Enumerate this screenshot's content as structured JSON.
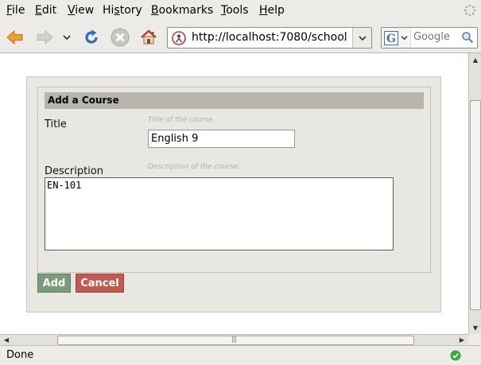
{
  "menubar": {
    "items": [
      {
        "pre": "",
        "u": "F",
        "post": "ile"
      },
      {
        "pre": "",
        "u": "E",
        "post": "dit"
      },
      {
        "pre": "",
        "u": "V",
        "post": "iew"
      },
      {
        "pre": "Hi",
        "u": "s",
        "post": "tory"
      },
      {
        "pre": "",
        "u": "B",
        "post": "ookmarks"
      },
      {
        "pre": "",
        "u": "T",
        "post": "ools"
      },
      {
        "pre": "",
        "u": "H",
        "post": "elp"
      }
    ]
  },
  "navbar": {
    "url": "http://localhost:7080/school",
    "search_placeholder": "Google"
  },
  "form": {
    "header": "Add a Course",
    "title_label": "Title",
    "title_hint": "Title of the course.",
    "title_value": "English 9",
    "description_label": "Description",
    "description_hint": "Description of the course.",
    "description_value": "EN-101",
    "add_label": "Add",
    "cancel_label": "Cancel"
  },
  "status": {
    "text": "Done"
  },
  "colors": {
    "add_button": "#7b9c79",
    "cancel_button": "#c05a52",
    "form_header": "#b8b6ac"
  },
  "icons": [
    "back-arrow-icon",
    "forward-arrow-icon",
    "history-dropdown-icon",
    "reload-icon",
    "stop-icon",
    "home-icon",
    "site-identity-icon",
    "bookmark-star-icon",
    "url-dropdown-icon",
    "google-icon",
    "search-go-icon",
    "throbber-icon",
    "secure-check-icon"
  ]
}
